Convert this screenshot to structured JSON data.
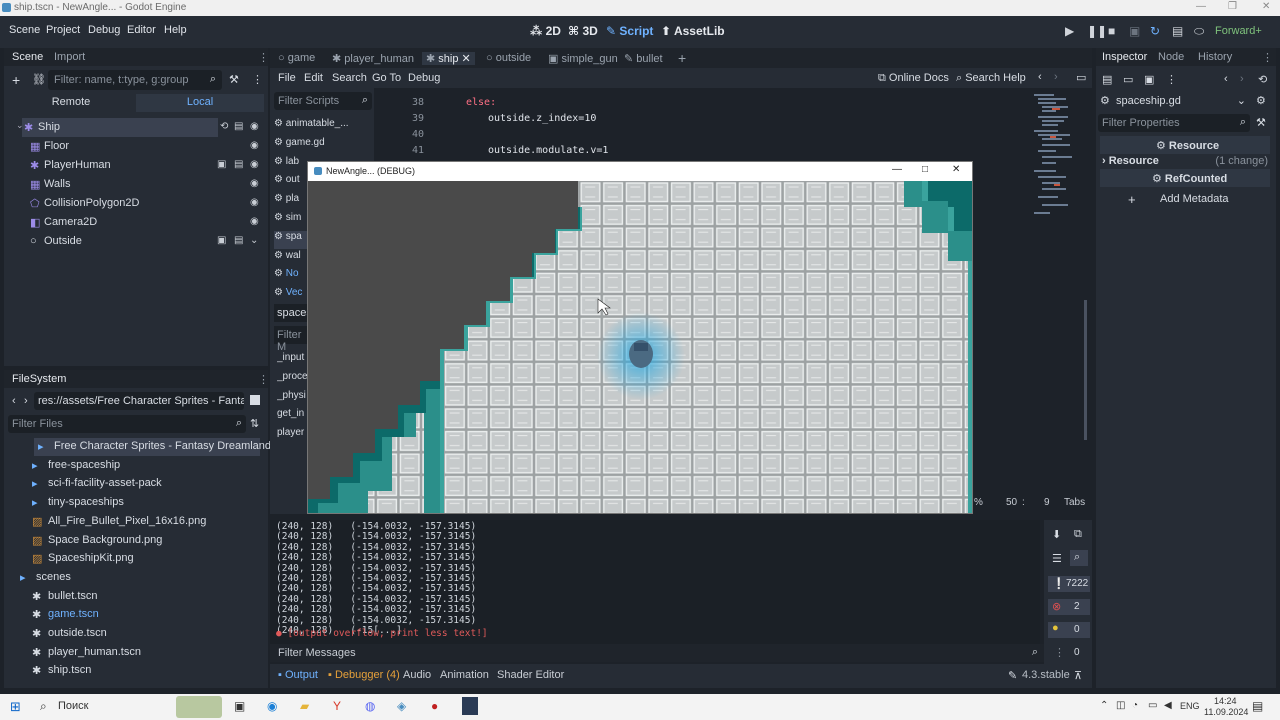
{
  "window": {
    "title": "ship.tscn - NewAngle... - Godot Engine"
  },
  "menu": [
    "Scene",
    "Project",
    "Debug",
    "Editor",
    "Help"
  ],
  "workspaces": [
    {
      "label": "2D",
      "icon": "2d-icon"
    },
    {
      "label": "3D",
      "icon": "3d-icon"
    },
    {
      "label": "Script",
      "icon": "script-icon",
      "active": true
    },
    {
      "label": "AssetLib",
      "icon": "assetlib-icon"
    }
  ],
  "renderer": "Forward+",
  "scene_dock": {
    "tabs": [
      "Scene",
      "Import"
    ],
    "filter_placeholder": "Filter: name, t:type, g:group",
    "remote": "Remote",
    "local": "Local",
    "nodes": [
      {
        "label": "Ship",
        "icon": "ship-node-icon",
        "indent": 0
      },
      {
        "label": "Floor",
        "icon": "tilemap-icon",
        "indent": 1
      },
      {
        "label": "PlayerHuman",
        "icon": "scene-icon",
        "indent": 1
      },
      {
        "label": "Walls",
        "icon": "tilemap-icon",
        "indent": 1
      },
      {
        "label": "CollisionPolygon2D",
        "icon": "collision-icon",
        "indent": 1
      },
      {
        "label": "Camera2D",
        "icon": "camera-icon",
        "indent": 1
      },
      {
        "label": "Outside",
        "icon": "node-icon",
        "indent": 1
      }
    ]
  },
  "filesystem": {
    "title": "FileSystem",
    "path": "res://assets/Free Character Sprites - Fantasy D",
    "filter_placeholder": "Filter Files",
    "items": [
      {
        "label": "Free Character Sprites - Fantasy Dreamland",
        "type": "folder",
        "indent": 1,
        "selected": true
      },
      {
        "label": "free-spaceship",
        "type": "folder",
        "indent": 1
      },
      {
        "label": "sci-fi-facility-asset-pack",
        "type": "folder",
        "indent": 1
      },
      {
        "label": "tiny-spaceships",
        "type": "folder",
        "indent": 1
      },
      {
        "label": "All_Fire_Bullet_Pixel_16x16.png",
        "type": "image",
        "indent": 1
      },
      {
        "label": "Space Background.png",
        "type": "image",
        "indent": 1
      },
      {
        "label": "SpaceshipKit.png",
        "type": "image",
        "indent": 1
      },
      {
        "label": "scenes",
        "type": "folder",
        "indent": 0
      },
      {
        "label": "bullet.tscn",
        "type": "scene",
        "indent": 1
      },
      {
        "label": "game.tscn",
        "type": "scene",
        "indent": 1
      },
      {
        "label": "outside.tscn",
        "type": "scene",
        "indent": 1
      },
      {
        "label": "player_human.tscn",
        "type": "scene",
        "indent": 1
      },
      {
        "label": "ship.tscn",
        "type": "scene",
        "indent": 1
      }
    ]
  },
  "editor_tabs": [
    {
      "label": "game",
      "active": false
    },
    {
      "label": "player_human",
      "active": false
    },
    {
      "label": "ship",
      "active": true
    },
    {
      "label": "outside",
      "active": false
    },
    {
      "label": "simple_gun",
      "active": false
    },
    {
      "label": "bullet",
      "active": false
    }
  ],
  "script_menu": [
    "File",
    "Edit",
    "Search",
    "Go To",
    "Debug"
  ],
  "script_help": {
    "online_docs": "Online Docs",
    "search_help": "Search Help"
  },
  "scripts_filter": "Filter Scripts",
  "scripts": [
    "animatable_...",
    "game.gd",
    "lab",
    "out",
    "pla",
    "sim",
    "spa",
    "wal",
    "No",
    "Vec"
  ],
  "scripts_current": "spaces",
  "methods_filter": "Filter M",
  "methods": [
    "_input",
    "_proce",
    "_physi",
    "get_in",
    "player"
  ],
  "code": [
    {
      "n": "38",
      "text": "else:"
    },
    {
      "n": "39",
      "text": "outside.z_index=10"
    },
    {
      "n": "40",
      "text": ""
    },
    {
      "n": "41",
      "text": "outside.modulate.v=1"
    }
  ],
  "status": {
    "line": "50",
    "col": "9",
    "indent": "Tabs"
  },
  "game_window": {
    "title": "NewAngle... (DEBUG)"
  },
  "output": {
    "lines": [
      "(240, 128)   (-154.0032, -157.3145)",
      "(240, 128)   (-154.0032, -157.3145)",
      "(240, 128)   (-154.0032, -157.3145)",
      "(240, 128)   (-154.0032, -157.3145)",
      "(240, 128)   (-154.0032, -157.3145)",
      "(240, 128)   (-154.0032, -157.3145)",
      "(240, 128)   (-154.0032, -157.3145)",
      "(240, 128)   (-154.0032, -157.3145)",
      "(240, 128)   (-154.0032, -157.3145)",
      "(240, 128)   (-154.0032, -157.3145)",
      "(240, 128)   (-15[...]"
    ],
    "overflow": "[output overflow, print less text!]",
    "filter_placeholder": "Filter Messages",
    "counts": {
      "messages": "7222",
      "errors": "2",
      "warnings": "0",
      "other": "0"
    }
  },
  "bottom_tabs": [
    "Output",
    "Debugger (4)",
    "Audio",
    "Animation",
    "Shader Editor"
  ],
  "version": "4.3.stable",
  "inspector": {
    "tabs": [
      "Inspector",
      "Node",
      "History"
    ],
    "file": "spaceship.gd",
    "filter_placeholder": "Filter Properties",
    "resource_header": "Resource",
    "resource_row": "Resource",
    "change_note": "(1 change)",
    "refcounted": "RefCounted",
    "add_metadata": "Add Metadata"
  },
  "taskbar": {
    "search": "Поиск",
    "lang": "ENG",
    "time": "14:24",
    "date": "11.09.2024"
  },
  "colors": {
    "accent": "#6fb2ff",
    "panel": "#262c35",
    "bg": "#1d2229",
    "error": "#e05050",
    "warning": "#e5c43a"
  }
}
